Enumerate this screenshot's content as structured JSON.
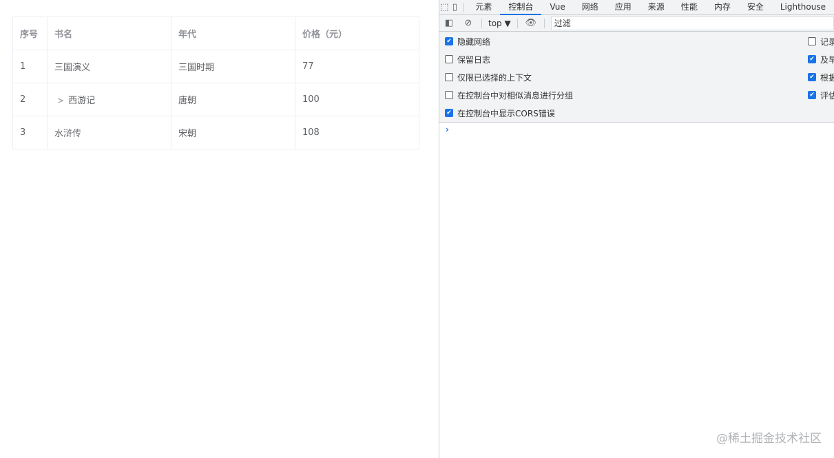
{
  "table": {
    "headers": [
      "序号",
      "书名",
      "年代",
      "价格（元）"
    ],
    "rows": [
      {
        "index": "1",
        "name": "三国演义",
        "era": "三国时期",
        "price": "77",
        "expandable": false
      },
      {
        "index": "2",
        "name": "西游记",
        "era": "唐朝",
        "price": "100",
        "expandable": true
      },
      {
        "index": "3",
        "name": "水浒传",
        "era": "宋朝",
        "price": "108",
        "expandable": false
      }
    ]
  },
  "devtools": {
    "tabs": [
      "元素",
      "控制台",
      "Vue",
      "网络",
      "应用",
      "来源",
      "性能",
      "内存",
      "安全",
      "Lighthouse"
    ],
    "active_tab": "控制台",
    "context": "top ▼",
    "filter_placeholder": "过滤",
    "left_options": [
      {
        "label": "隐藏网络",
        "checked": true
      },
      {
        "label": "保留日志",
        "checked": false
      },
      {
        "label": "仅限已选择的上下文",
        "checked": false
      },
      {
        "label": "在控制台中对相似消息进行分组",
        "checked": false
      },
      {
        "label": "在控制台中显示CORS错误",
        "checked": true
      }
    ],
    "right_options": [
      {
        "label": "记录",
        "checked": false
      },
      {
        "label": "及早",
        "checked": true
      },
      {
        "label": "根据",
        "checked": true
      },
      {
        "label": "评估",
        "checked": true
      }
    ],
    "prompt": "›"
  },
  "watermark": "@稀土掘金技术社区",
  "colors": {
    "accent": "#1a73e8",
    "border": "#ebeef5"
  }
}
